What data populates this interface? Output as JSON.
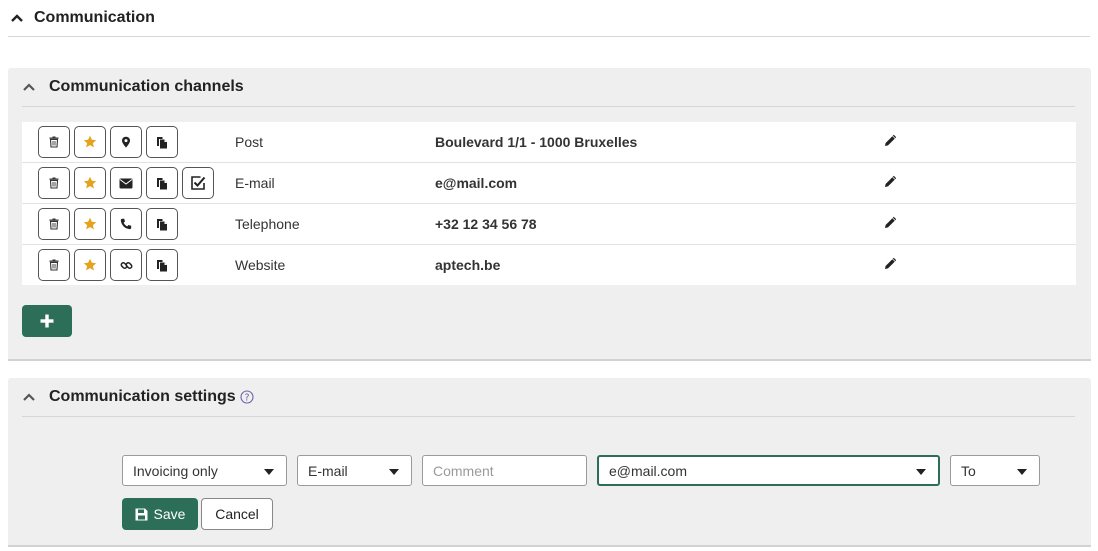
{
  "section": {
    "title": "Communication"
  },
  "channels_panel": {
    "title": "Communication channels",
    "rows": [
      {
        "type": "Post",
        "value": "Boulevard 1/1 - 1000 Bruxelles",
        "icon": "map-marker-icon",
        "has_check": false
      },
      {
        "type": "E-mail",
        "value": "e@mail.com",
        "icon": "envelope-icon",
        "has_check": true
      },
      {
        "type": "Telephone",
        "value": "+32 12 34 56 78",
        "icon": "phone-icon",
        "has_check": false
      },
      {
        "type": "Website",
        "value": "aptech.be",
        "icon": "link-icon",
        "has_check": false
      }
    ]
  },
  "settings_panel": {
    "title": "Communication settings",
    "purpose": "Invoicing only",
    "channel": "E-mail",
    "comment_placeholder": "Comment",
    "address": "e@mail.com",
    "recipient": "To",
    "save_label": "Save",
    "cancel_label": "Cancel"
  },
  "colors": {
    "accent": "#2d6e58",
    "star": "#e5a21c",
    "panel_bg": "#efefef"
  }
}
